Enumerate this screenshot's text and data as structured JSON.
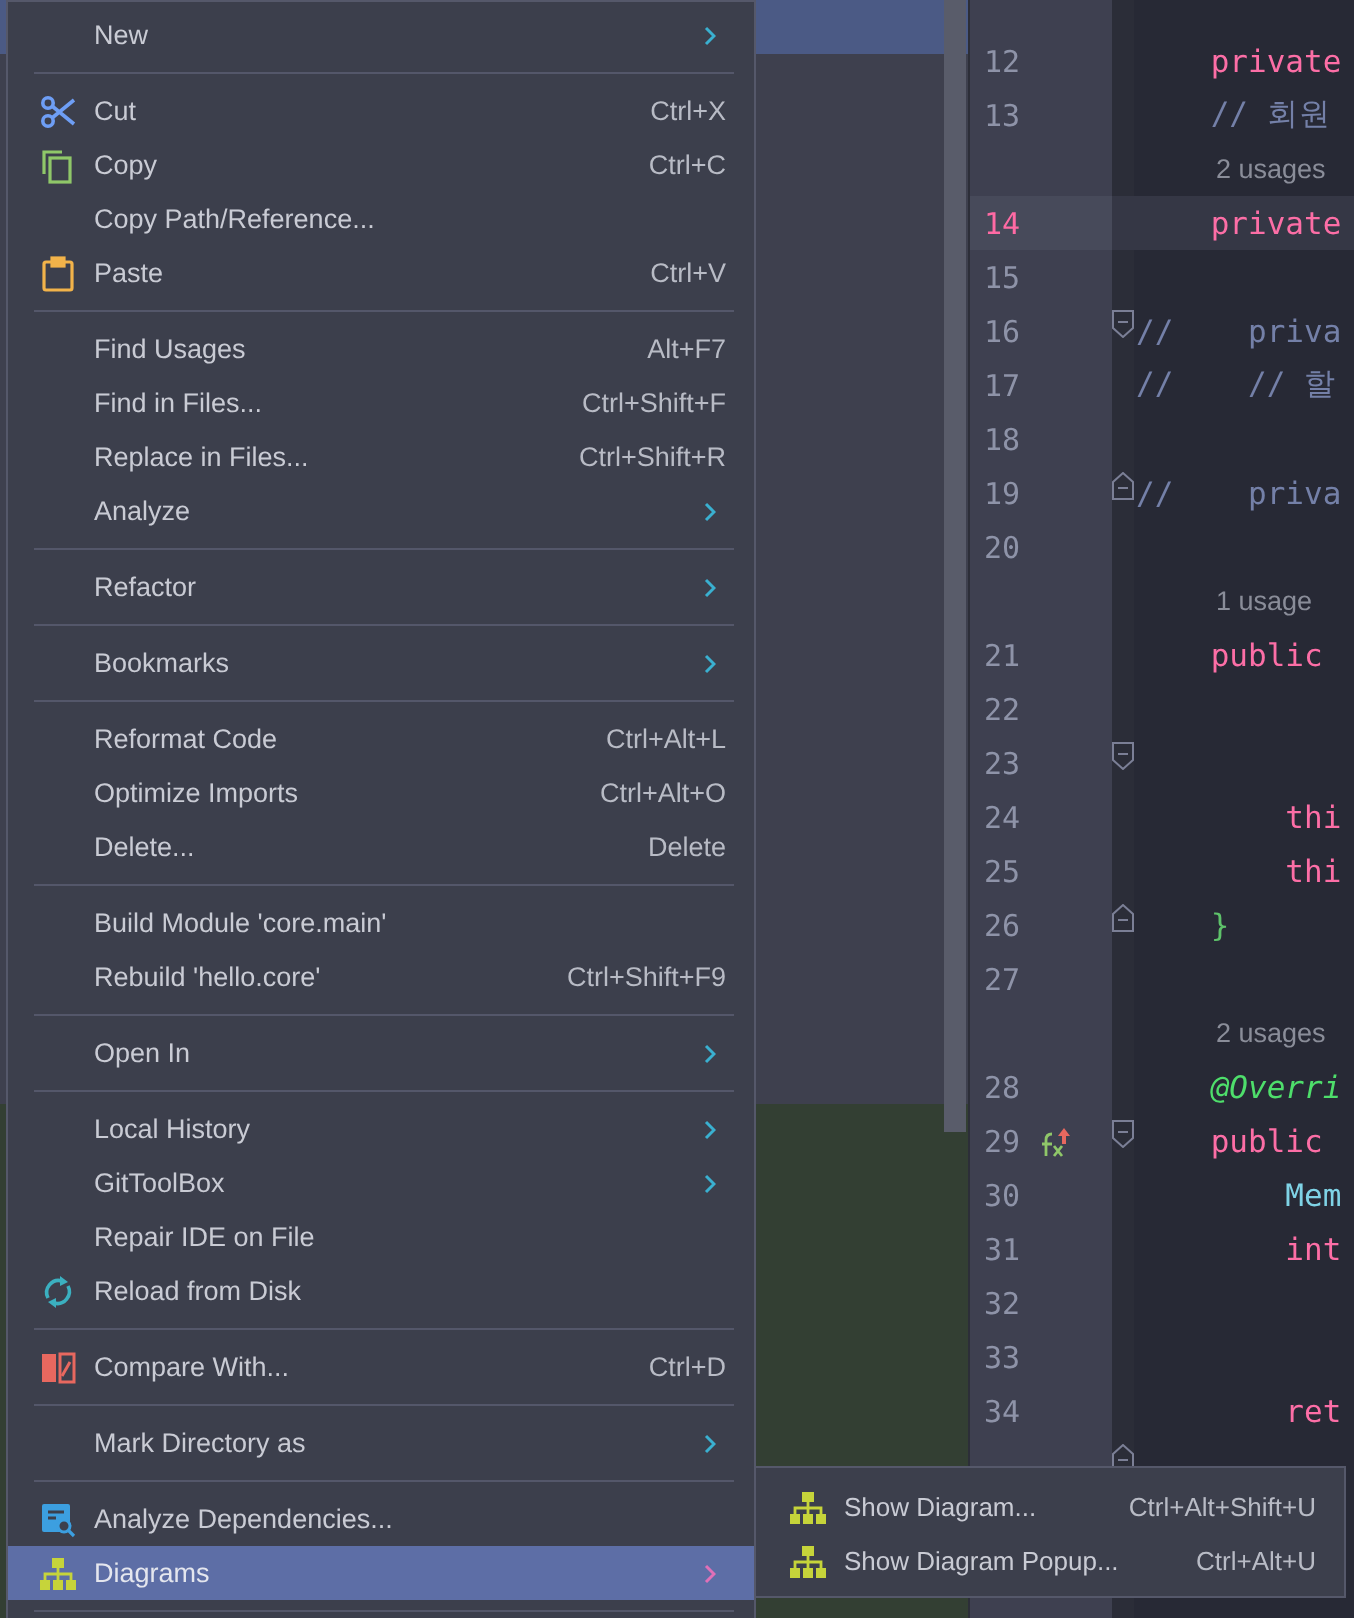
{
  "editor": {
    "lines": [
      {
        "kind": "inlay"
      },
      {
        "kind": "code",
        "number": "12",
        "current": false,
        "tokens": [
          {
            "kind": "keyword",
            "text": "    private"
          }
        ]
      },
      {
        "kind": "code",
        "number": "13",
        "current": false,
        "tokens": [
          {
            "kind": "comment",
            "text": "    // 회원"
          }
        ]
      },
      {
        "kind": "inlay",
        "text": "2 usages"
      },
      {
        "kind": "code",
        "number": "14",
        "current": true,
        "tokens": [
          {
            "kind": "keyword",
            "text": "    private"
          }
        ]
      },
      {
        "kind": "code",
        "number": "15",
        "current": false
      },
      {
        "kind": "code",
        "number": "16",
        "current": false,
        "fold_marker": {
          "kind": "start"
        },
        "tokens": [
          {
            "kind": "comment",
            "text": "//    priva"
          }
        ]
      },
      {
        "kind": "code",
        "number": "17",
        "current": false,
        "tokens": [
          {
            "kind": "comment",
            "text": "//    // 할"
          }
        ]
      },
      {
        "kind": "code",
        "number": "18",
        "current": false
      },
      {
        "kind": "code",
        "number": "19",
        "current": false,
        "fold_marker": {
          "kind": "end"
        },
        "tokens": [
          {
            "kind": "comment",
            "text": "//    priva"
          }
        ]
      },
      {
        "kind": "code",
        "number": "20",
        "current": false
      },
      {
        "kind": "inlay",
        "text": "1 usage"
      },
      {
        "kind": "code",
        "number": "21",
        "current": false,
        "tokens": [
          {
            "kind": "keyword",
            "text": "    public"
          }
        ]
      },
      {
        "kind": "code",
        "number": "22",
        "current": false
      },
      {
        "kind": "code",
        "number": "23",
        "current": false,
        "fold_marker": {
          "kind": "start"
        }
      },
      {
        "kind": "code",
        "number": "24",
        "current": false,
        "tokens": [
          {
            "kind": "keyword",
            "text": "        thi"
          }
        ]
      },
      {
        "kind": "code",
        "number": "25",
        "current": false,
        "tokens": [
          {
            "kind": "keyword",
            "text": "        thi"
          }
        ]
      },
      {
        "kind": "code",
        "number": "26",
        "current": false,
        "fold_marker": {
          "kind": "end"
        },
        "tokens": [
          {
            "kind": "brace",
            "text": "    }"
          }
        ]
      },
      {
        "kind": "code",
        "number": "27",
        "current": false
      },
      {
        "kind": "inlay",
        "text": "2 usages"
      },
      {
        "kind": "code",
        "number": "28",
        "current": false,
        "tokens": [
          {
            "kind": "annotation",
            "text": "    @Overri"
          }
        ]
      },
      {
        "kind": "code",
        "number": "29",
        "current": false,
        "fold_marker": {
          "kind": "start"
        },
        "gutter_icon": true,
        "tokens": [
          {
            "kind": "keyword",
            "text": "    public"
          }
        ]
      },
      {
        "kind": "code",
        "number": "30",
        "current": false,
        "tokens": [
          {
            "kind": "type",
            "text": "        Mem"
          }
        ]
      },
      {
        "kind": "code",
        "number": "31",
        "current": false,
        "tokens": [
          {
            "kind": "keyword",
            "text": "        int"
          }
        ]
      },
      {
        "kind": "code",
        "number": "32",
        "current": false
      },
      {
        "kind": "code",
        "number": "33",
        "current": false
      },
      {
        "kind": "code",
        "number": "34",
        "current": false,
        "tokens": [
          {
            "kind": "keyword",
            "text": "        ret"
          }
        ]
      },
      {
        "kind": "code",
        "current": false,
        "fold_marker": {
          "kind": "end"
        }
      }
    ]
  },
  "context_menu": {
    "items": [
      {
        "kind": "item",
        "label": "New",
        "submenu": true,
        "selected": false
      },
      {
        "kind": "separator"
      },
      {
        "kind": "item",
        "label": "Cut",
        "shortcut": "Ctrl+X",
        "submenu": false,
        "selected": false
      },
      {
        "kind": "item",
        "label": "Copy",
        "shortcut": "Ctrl+C",
        "submenu": false,
        "selected": false
      },
      {
        "kind": "item",
        "label": "Copy Path/Reference...",
        "submenu": false,
        "selected": false
      },
      {
        "kind": "item",
        "label": "Paste",
        "shortcut": "Ctrl+V",
        "submenu": false,
        "selected": false
      },
      {
        "kind": "separator"
      },
      {
        "kind": "item",
        "label": "Find Usages",
        "shortcut": "Alt+F7",
        "submenu": false,
        "selected": false
      },
      {
        "kind": "item",
        "label": "Find in Files...",
        "shortcut": "Ctrl+Shift+F",
        "submenu": false,
        "selected": false
      },
      {
        "kind": "item",
        "label": "Replace in Files...",
        "shortcut": "Ctrl+Shift+R",
        "submenu": false,
        "selected": false
      },
      {
        "kind": "item",
        "label": "Analyze",
        "submenu": true,
        "selected": false
      },
      {
        "kind": "separator"
      },
      {
        "kind": "item",
        "label": "Refactor",
        "submenu": true,
        "selected": false
      },
      {
        "kind": "separator"
      },
      {
        "kind": "item",
        "label": "Bookmarks",
        "submenu": true,
        "selected": false
      },
      {
        "kind": "separator"
      },
      {
        "kind": "item",
        "label": "Reformat Code",
        "shortcut": "Ctrl+Alt+L",
        "submenu": false,
        "selected": false
      },
      {
        "kind": "item",
        "label": "Optimize Imports",
        "shortcut": "Ctrl+Alt+O",
        "submenu": false,
        "selected": false
      },
      {
        "kind": "item",
        "label": "Delete...",
        "shortcut": "Delete",
        "submenu": false,
        "selected": false
      },
      {
        "kind": "separator"
      },
      {
        "kind": "item",
        "label": "Build Module 'core.main'",
        "submenu": false,
        "selected": false
      },
      {
        "kind": "item",
        "label": "Rebuild 'hello.core'",
        "shortcut": "Ctrl+Shift+F9",
        "submenu": false,
        "selected": false
      },
      {
        "kind": "separator"
      },
      {
        "kind": "item",
        "label": "Open In",
        "submenu": true,
        "selected": false
      },
      {
        "kind": "separator"
      },
      {
        "kind": "item",
        "label": "Local History",
        "submenu": true,
        "selected": false
      },
      {
        "kind": "item",
        "label": "GitToolBox",
        "submenu": true,
        "selected": false
      },
      {
        "kind": "item",
        "label": "Repair IDE on File",
        "submenu": false,
        "selected": false
      },
      {
        "kind": "item",
        "label": "Reload from Disk",
        "submenu": false,
        "selected": false
      },
      {
        "kind": "separator"
      },
      {
        "kind": "item",
        "label": "Compare With...",
        "shortcut": "Ctrl+D",
        "submenu": false,
        "selected": false
      },
      {
        "kind": "separator"
      },
      {
        "kind": "item",
        "label": "Mark Directory as",
        "submenu": true,
        "selected": false
      },
      {
        "kind": "separator"
      },
      {
        "kind": "item",
        "label": "Analyze Dependencies...",
        "submenu": false,
        "selected": false
      },
      {
        "kind": "item",
        "label": "Diagrams",
        "submenu": true,
        "selected": true
      },
      {
        "kind": "separator"
      }
    ]
  },
  "submenu": {
    "items": [
      {
        "label": "Show Diagram...",
        "shortcut": "Ctrl+Alt+Shift+U",
        "selected": false
      },
      {
        "label": "Show Diagram Popup...",
        "shortcut": "Ctrl+Alt+U",
        "selected": false
      }
    ]
  }
}
